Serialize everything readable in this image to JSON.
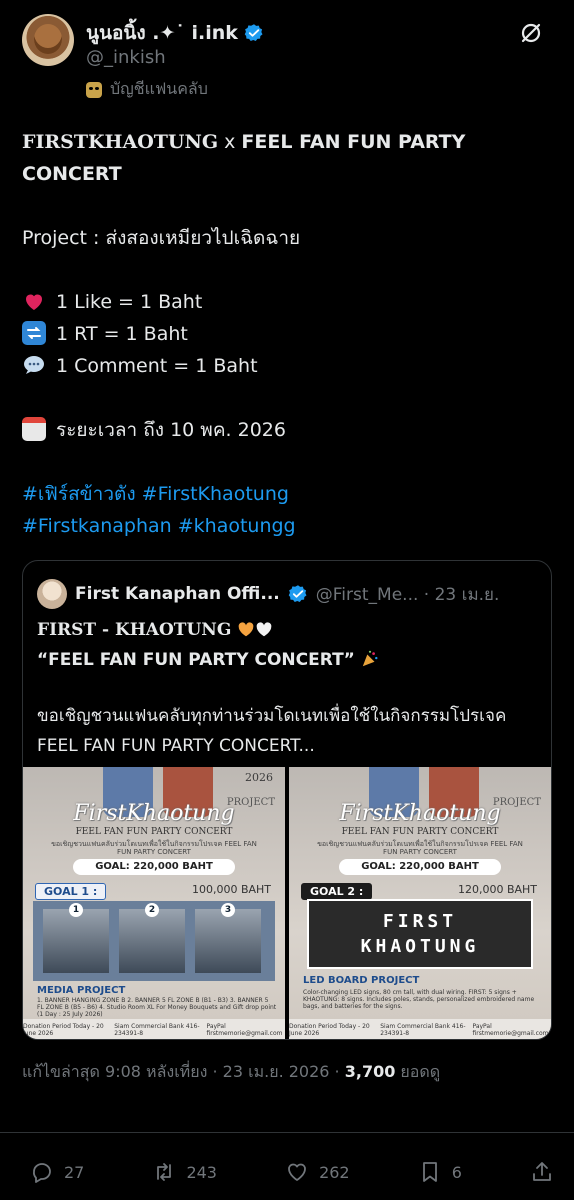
{
  "author": {
    "display_name": "นูนอนิ้ง .✦˙ i.ink",
    "handle": "@_inkish",
    "account_type": "บัญชีแฟนคลับ"
  },
  "post": {
    "title_serif": "FIRSTKHAOTUNG",
    "title_x": " x ",
    "title_rest": "FEEL FAN FUN PARTY CONCERT",
    "project_line": "Project : ส่งสองเหมียวไปเฉิดฉาย",
    "like_line": "1 Like = 1 Baht",
    "rt_line": "1 RT = 1 Baht",
    "comment_line": "1 Comment = 1 Baht",
    "period_line": "ระยะเวลา ถึง 10 พค. 2026",
    "hashtags_line1": "#เฟิร์สข้าวตัง #FirstKhaotung",
    "hashtags_line2": "#Firstkanaphan #khaotungg"
  },
  "quote": {
    "name": "First Kanaphan Offi...",
    "handle_time": "@First_Me... · 23 เม.ย.",
    "title": "FIRST - KHAOTUNG",
    "subtitle": "“FEEL FAN FUN PARTY CONCERT”",
    "text": "ขอเชิญชวนแฟนคลับทุกท่านร่วมโดเนทเพื่อใช้ในกิจกรรมโปรเจค FEEL FAN FUN PARTY CONCERT..."
  },
  "posters": {
    "year": "2026",
    "project": "PROJECT",
    "brand": "FirstKhaotung",
    "concert": "FEEL FAN FUN PARTY CONCERT",
    "small_text": "ขอเชิญชวนแฟนคลับร่วมโดเนทเพื่อใช้ในกิจกรรมโปรเจค FEEL FAN FUN PARTY CONCERT",
    "goal_total": "GOAL: 220,000 BAHT",
    "left": {
      "goal": "GOAL 1 :",
      "goal_amount": "100,000 BAHT",
      "photo_nums": [
        "1",
        "2",
        "3"
      ],
      "media_title": "MEDIA PROJECT",
      "media_list": "1. BANNER HANGING ZONE B  2. BANNER 5 FL ZONE B (B1 - B3)  3. BANNER 5 FL ZONE B (B5 - B6)  4. Studio Room XL For Money Bouquets and Gift drop point (1 Day : 25 July 2026)",
      "foot_left": "Donation Period  Today - 20 June 2026",
      "foot_mid": "Siam Commercial Bank  416-234391-8",
      "foot_right": "PayPal  firstmemorie@gmail.com"
    },
    "right": {
      "goal": "GOAL 2 :",
      "goal_amount": "120,000 BAHT",
      "word1": "FIRST",
      "word2": "KHAOTUNG",
      "led_title": "LED BOARD PROJECT",
      "led_desc": "Color-changing LED signs, 80 cm tall, with dual wiring. FIRST: 5 signs + KHAOTUNG: 8 signs. Includes poles, stands, personalized embroidered name bags, and batteries for the signs.",
      "foot_left": "Donation Period  Today - 20 June 2026",
      "foot_mid": "Siam Commercial Bank  416-234391-8",
      "foot_right": "PayPal  firstmemorie@gmail.com"
    }
  },
  "meta": {
    "edited": "แก้ไขล่าสุด 9:08 หลังเที่ยง · 23 เม.ย. 2026 · ",
    "views_count": "3,700",
    "views_label": " ยอดดู"
  },
  "actions": {
    "replies": "27",
    "reposts": "243",
    "likes": "262",
    "bookmarks": "6"
  },
  "colors": {
    "background": "#000000",
    "text": "#e7e9ea",
    "secondary": "#71767b",
    "link": "#1d9bf0",
    "border": "#2f3336",
    "verified": "#1d9bf0"
  },
  "icons": [
    "verified-icon",
    "mask-icon",
    "grok-icon",
    "heart-icon",
    "repeat-icon",
    "comment-icon",
    "calendar-icon",
    "orange-heart-icon",
    "white-heart-icon",
    "party-icon",
    "reply-icon",
    "repost-icon",
    "like-icon",
    "bookmark-icon",
    "share-icon"
  ]
}
